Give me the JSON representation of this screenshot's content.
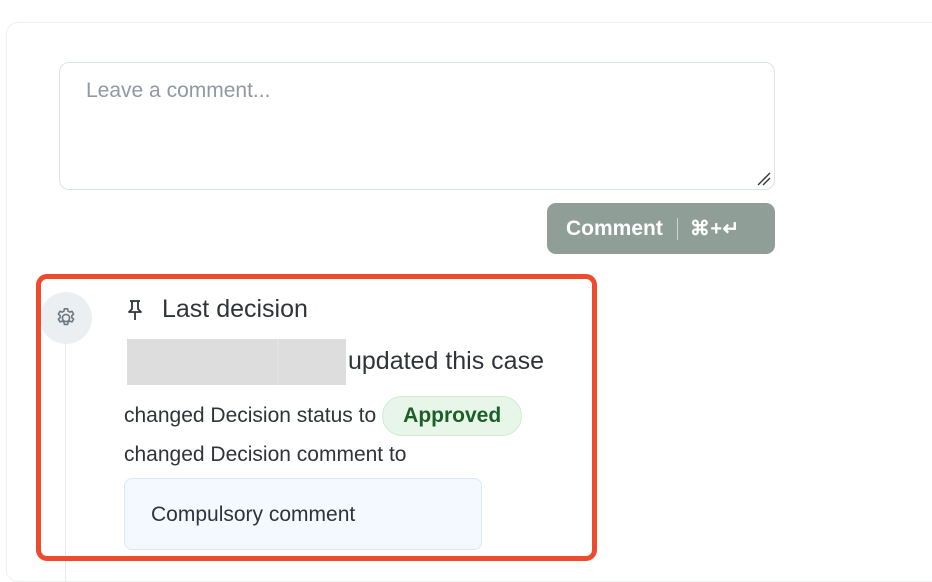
{
  "composer": {
    "placeholder": "Leave a comment...",
    "button_label": "Comment",
    "shortcut": "⌘+↵"
  },
  "event": {
    "title": "Last decision",
    "action": "updated this case",
    "changes": [
      {
        "text": "changed Decision status to",
        "value": "Approved"
      },
      {
        "text": "changed Decision comment to",
        "value": "Compulsory comment"
      }
    ]
  },
  "colors": {
    "highlight": "#ee4a2d",
    "button": "#8f9e97",
    "approved_bg": "#e8f6e9",
    "approved_text": "#1d5f28"
  },
  "icons": {
    "event_type": "gear-icon",
    "title": "pin-icon",
    "resize": "resize-handle-icon"
  }
}
